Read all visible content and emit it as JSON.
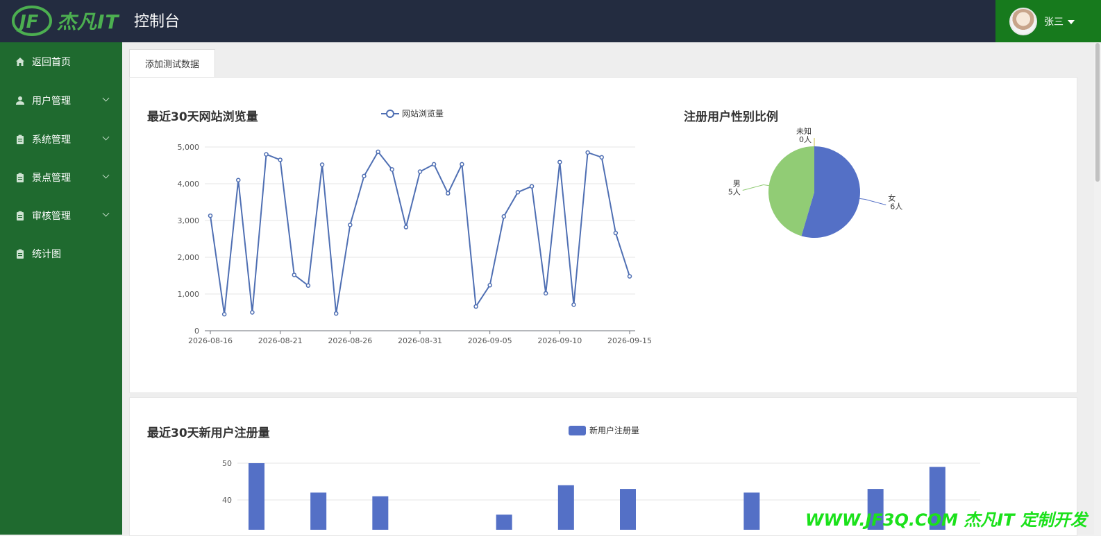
{
  "header": {
    "logo_text": "杰凡IT",
    "title": "控制台",
    "user_name": "张三"
  },
  "sidebar": {
    "items": [
      {
        "label": "返回首页",
        "icon": "home-icon",
        "expandable": false
      },
      {
        "label": "用户管理",
        "icon": "user-icon",
        "expandable": true
      },
      {
        "label": "系统管理",
        "icon": "clipboard-icon",
        "expandable": true
      },
      {
        "label": "景点管理",
        "icon": "clipboard-icon",
        "expandable": true
      },
      {
        "label": "审核管理",
        "icon": "clipboard-icon",
        "expandable": true
      },
      {
        "label": "统计图",
        "icon": "clipboard-icon",
        "expandable": false
      }
    ]
  },
  "tab": {
    "label": "添加测试数据"
  },
  "colors": {
    "header": "#232c40",
    "sidebar": "#1f6a2f",
    "user_box": "#177a1d",
    "line": "#4f6fb3",
    "bar": "#5470c6",
    "pie_blue": "#5470c6",
    "pie_green": "#91cc75"
  },
  "watermark": "WWW.JF3Q.COM 杰凡IT  定制开发",
  "chart_data": [
    {
      "type": "line",
      "title": "最近30天网站浏览量",
      "legend": "网站浏览量",
      "x": [
        "2026-08-16",
        "2026-08-17",
        "2026-08-18",
        "2026-08-19",
        "2026-08-20",
        "2026-08-21",
        "2026-08-22",
        "2026-08-23",
        "2026-08-24",
        "2026-08-25",
        "2026-08-26",
        "2026-08-27",
        "2026-08-28",
        "2026-08-29",
        "2026-08-30",
        "2026-08-31",
        "2026-09-01",
        "2026-09-02",
        "2026-09-03",
        "2026-09-04",
        "2026-09-05",
        "2026-09-06",
        "2026-09-07",
        "2026-09-08",
        "2026-09-09",
        "2026-09-10",
        "2026-09-11",
        "2026-09-12",
        "2026-09-13",
        "2026-09-14",
        "2026-09-15"
      ],
      "values": [
        3130,
        450,
        4100,
        500,
        4800,
        4650,
        1520,
        1230,
        4520,
        470,
        2880,
        4210,
        4870,
        4390,
        2820,
        4330,
        4530,
        3740,
        4530,
        660,
        1240,
        3110,
        3770,
        3930,
        1020,
        4590,
        710,
        4850,
        4720,
        2660,
        1480
      ],
      "x_ticks": [
        "2026-08-16",
        "2026-08-21",
        "2026-08-26",
        "2026-08-31",
        "2026-09-05",
        "2026-09-10",
        "2026-09-15"
      ],
      "y_ticks": [
        "0",
        "1,000",
        "2,000",
        "3,000",
        "4,000",
        "5,000"
      ],
      "ylim": [
        0,
        5000
      ]
    },
    {
      "type": "pie",
      "title": "注册用户性别比例",
      "slices": [
        {
          "name": "女",
          "value": 6,
          "label": "6人"
        },
        {
          "name": "男",
          "value": 5,
          "label": "5人"
        },
        {
          "name": "未知",
          "value": 0,
          "label": "0人"
        }
      ]
    },
    {
      "type": "bar",
      "title": "最近30天新用户注册量",
      "legend": "新用户注册量",
      "values": [
        50,
        42,
        41,
        null,
        36,
        44,
        43,
        null,
        42,
        null,
        43,
        49
      ],
      "y_ticks": [
        "50",
        "40"
      ],
      "ylim": [
        35,
        50
      ]
    }
  ]
}
